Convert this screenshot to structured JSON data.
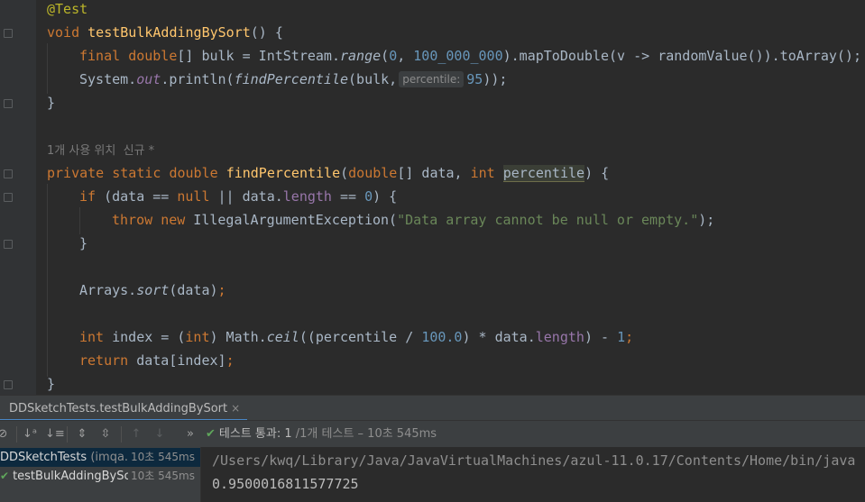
{
  "editor": {
    "lines": {
      "l1": {
        "annotation": "@Test"
      },
      "l2": {
        "kw": "void",
        "name": "testBulkAddingBySort",
        "rest": "() {"
      },
      "l3": {
        "kw1": "final",
        "kw2": "double",
        "t1": "[] bulk = IntStream.",
        "m1": "range",
        "t2": "(",
        "n1": "0",
        "t3": ", ",
        "n2": "100_000_000",
        "t4": ").mapToDouble(v -> randomValue()).toArray();"
      },
      "l4": {
        "t1": "System.",
        "f1": "out",
        "t2": ".println(",
        "m1": "findPercentile",
        "t3": "(bulk,",
        "hint": "percentile:",
        "n1": "95",
        "t4": "));"
      },
      "l5": {
        "t1": "}"
      },
      "l6": {
        "usage": "1개 사용 위치  신규 *"
      },
      "l7": {
        "kw1": "private",
        "kw2": "static",
        "kw3": "double",
        "name": "findPercentile",
        "t1": "(",
        "kw4": "double",
        "t2": "[] data, ",
        "kw5": "int",
        "param": "percentile",
        "t3": ") {"
      },
      "l8": {
        "kw1": "if",
        "t1": " (data == ",
        "kw2": "null",
        "t2": " || data.",
        "f1": "length",
        "t3": " == ",
        "n1": "0",
        "t4": ") {"
      },
      "l9": {
        "kw1": "throw",
        "kw2": "new",
        "t1": " IllegalArgumentException(",
        "s1": "\"Data array cannot be null or empty.\"",
        "t2": ");"
      },
      "l10": {
        "t1": "}"
      },
      "l11": {
        "t1": "Arrays.",
        "m1": "sort",
        "t2": "(data)",
        "semi": ";"
      },
      "l12": {
        "kw1": "int",
        "t1": " index = (",
        "kw2": "int",
        "t2": ") Math.",
        "m1": "ceil",
        "t3": "((percentile / ",
        "n1": "100.0",
        "t4": ") * data.",
        "f1": "length",
        "t5": ") - ",
        "n2": "1",
        "semi": ";"
      },
      "l13": {
        "kw1": "return",
        "t1": " data[index]",
        "semi": ";"
      },
      "l14": {
        "t1": "}"
      }
    }
  },
  "run_panel": {
    "tab_label": "DDSketchTests.testBulkAddingBySort",
    "tab_close": "×",
    "status": {
      "label": "테스트 통과:",
      "count": "1",
      "detail": "/1개 테스트 – 10초 545ms"
    },
    "tree": {
      "root": {
        "name": "DDSketchTests",
        "paren": "(imqa.s",
        "time": "10초 545ms"
      },
      "child": {
        "name": "testBulkAddingBySor",
        "time": "10초 545ms"
      }
    },
    "console": {
      "path": "/Users/kwq/Library/Java/JavaVirtualMachines/azul-11.0.17/Contents/Home/bin/java ...",
      "output": "0.9500016811577725"
    }
  },
  "icons": [
    "fold-icon",
    "sort-alpha-icon",
    "sort-duration-icon",
    "expand-all-icon",
    "collapse-all-icon",
    "prev-failed-icon",
    "next-failed-icon",
    "more-icon",
    "check-icon",
    "close-icon",
    "stop-icon"
  ],
  "colors": {
    "keyword": "#cc7832",
    "number": "#6897bb",
    "string": "#6a8759",
    "function": "#ffc66d",
    "field": "#9876aa",
    "annotation": "#bbb529",
    "pass": "#5fa65b"
  }
}
